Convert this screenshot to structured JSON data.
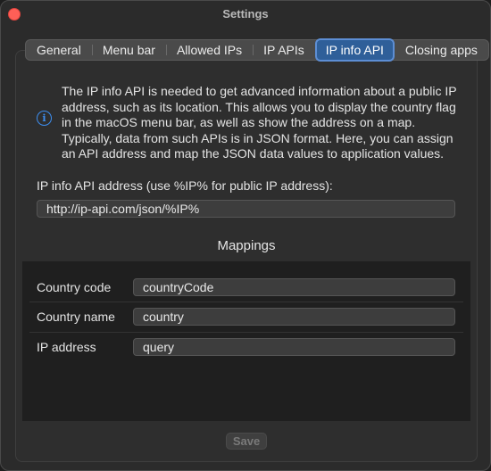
{
  "window": {
    "title": "Settings"
  },
  "tabs": [
    {
      "label": "General"
    },
    {
      "label": "Menu bar"
    },
    {
      "label": "Allowed IPs"
    },
    {
      "label": "IP APIs"
    },
    {
      "label": "IP info API",
      "active": true
    },
    {
      "label": "Closing apps"
    }
  ],
  "info": {
    "icon": "info-icon",
    "text": "The IP info API is needed to get advanced information about a public IP address, such as its location. This allows you to display the country flag in the macOS menu bar, as well as show the address on a map. Typically, data from such APIs is in JSON format. Here, you can assign an API address and map the JSON data values to application values."
  },
  "api_address": {
    "label": "IP info API address (use %IP% for public IP address):",
    "value": "http://ip-api.com/json/%IP%"
  },
  "mappings": {
    "title": "Mappings",
    "rows": [
      {
        "label": "Country code",
        "value": "countryCode"
      },
      {
        "label": "Country name",
        "value": "country"
      },
      {
        "label": "IP address",
        "value": "query"
      }
    ]
  },
  "footer": {
    "save_label": "Save",
    "save_enabled": false
  },
  "colors": {
    "accent": "#3d8ef0",
    "active_tab": "#2f5f99",
    "close_button": "#ff5f57"
  }
}
